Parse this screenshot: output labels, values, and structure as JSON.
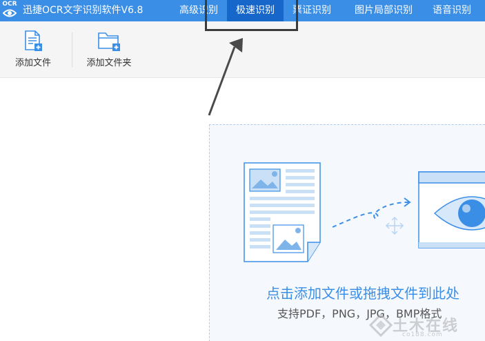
{
  "app": {
    "logo_text": "OCR",
    "title": "迅捷OCR文字识别软件V6.8"
  },
  "menu": {
    "items": [
      {
        "label": "高级识别"
      },
      {
        "label": "极速识别",
        "active": true
      },
      {
        "label": "票证识别"
      },
      {
        "label": "图片局部识别"
      },
      {
        "label": "语音识别"
      }
    ]
  },
  "toolbar": {
    "add_file_label": "添加文件",
    "add_folder_label": "添加文件夹"
  },
  "dropzone": {
    "main_text": "点击添加文件或拖拽文件到此处",
    "sub_text": "支持PDF，PNG，JPG，BMP格式"
  },
  "watermark": {
    "cn": "土木在线",
    "en": "co188.com"
  },
  "colors": {
    "menu_bg": "#3a8ee6",
    "menu_active": "#1766c9",
    "accent": "#3a8ee6",
    "toolbar_bg": "#f5f5f5"
  }
}
